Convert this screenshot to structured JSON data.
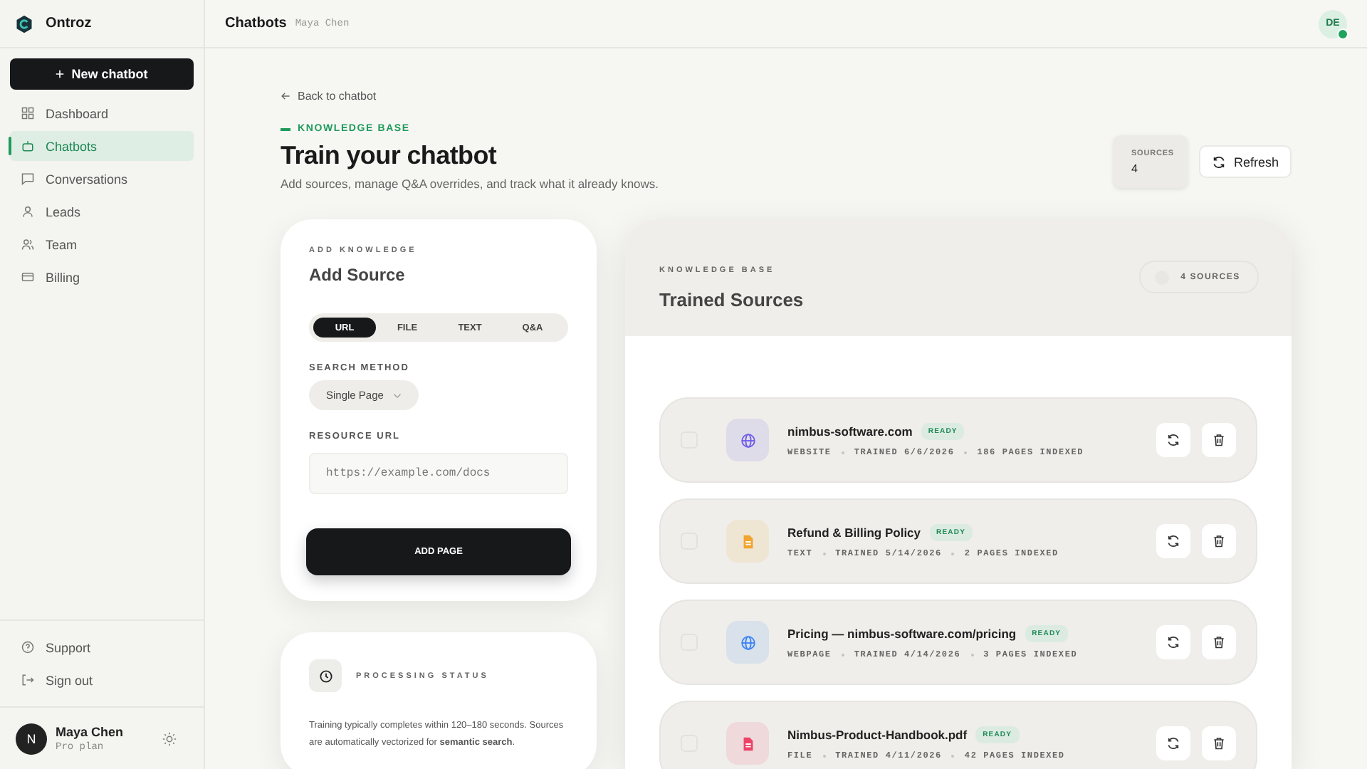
{
  "brand": {
    "name": "Ontroz"
  },
  "sidebar": {
    "new_button": "New chatbot",
    "items": [
      {
        "label": "Dashboard",
        "selected": false
      },
      {
        "label": "Chatbots",
        "selected": true
      },
      {
        "label": "Conversations",
        "selected": false
      },
      {
        "label": "Leads",
        "selected": false
      },
      {
        "label": "Team",
        "selected": false
      },
      {
        "label": "Billing",
        "selected": false
      }
    ],
    "footer_items": [
      {
        "label": "Support"
      },
      {
        "label": "Sign out"
      }
    ],
    "user": {
      "initial": "N",
      "name": "Maya Chen",
      "plan": "Pro plan"
    }
  },
  "topbar": {
    "title": "Chatbots",
    "subtitle": "Maya Chen",
    "avatar": "DE",
    "online": true
  },
  "header": {
    "back": "Back to chatbot",
    "eyebrow": "KNOWLEDGE BASE",
    "title": "Train your chatbot",
    "subtitle": "Add sources, manage Q&A overrides, and track what it already knows.",
    "stat_label": "SOURCES",
    "stat_value": "4",
    "refresh": "Refresh"
  },
  "add_card": {
    "eyebrow": "ADD KNOWLEDGE",
    "title": "Add Source",
    "tabs": [
      {
        "label": "URL",
        "selected": true
      },
      {
        "label": "FILE",
        "selected": false
      },
      {
        "label": "TEXT",
        "selected": false
      },
      {
        "label": "Q&A",
        "selected": false
      }
    ],
    "method_label": "SEARCH METHOD",
    "method_value": "Single Page",
    "url_label": "RESOURCE URL",
    "url_placeholder": "https://example.com/docs",
    "submit": "ADD PAGE"
  },
  "status_card": {
    "title": "PROCESSING STATUS",
    "text": "Training typically completes within 120–180 seconds. Sources are automatically vectorized for **semantic search**."
  },
  "sources_panel": {
    "eyebrow": "KNOWLEDGE BASE",
    "title": "Trained Sources",
    "count": "4 SOURCES",
    "items": [
      {
        "title": "nimbus-software.com",
        "kind": "globe",
        "color": "#6d5ce8",
        "status": "READY",
        "type": "WEBSITE",
        "trained": "TRAINED 6/6/2026",
        "pages": "186 PAGES INDEXED",
        "checked": false
      },
      {
        "title": "Refund & Billing Policy",
        "kind": "doc",
        "color": "#f0a531",
        "status": "READY",
        "type": "TEXT",
        "trained": "TRAINED 5/14/2026",
        "pages": "2 PAGES INDEXED",
        "checked": false
      },
      {
        "title": "Pricing — nimbus-software.com/pricing",
        "kind": "globe",
        "color": "#3b82f6",
        "status": "READY",
        "type": "WEBPAGE",
        "trained": "TRAINED 4/14/2026",
        "pages": "3 PAGES INDEXED",
        "checked": false
      },
      {
        "title": "Nimbus-Product-Handbook.pdf",
        "kind": "doc",
        "color": "#ec4468",
        "status": "READY",
        "type": "FILE",
        "trained": "TRAINED 4/11/2026",
        "pages": "42 PAGES INDEXED",
        "checked": false
      }
    ]
  }
}
